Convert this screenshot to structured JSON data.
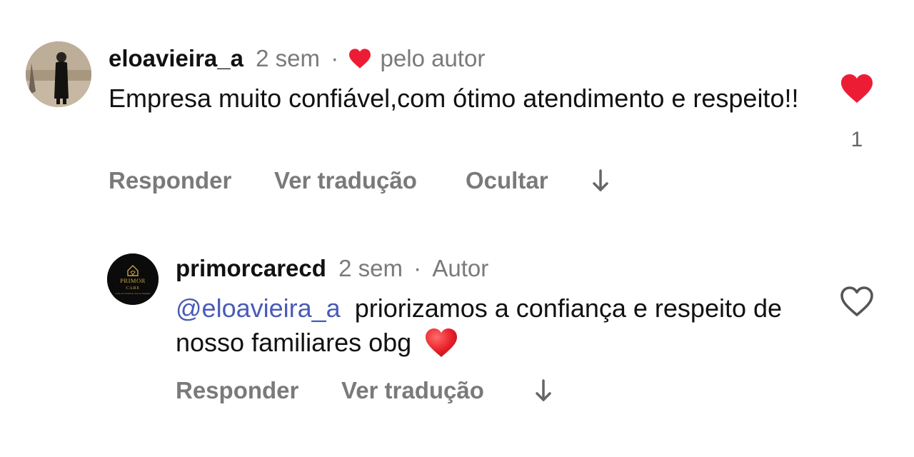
{
  "comments": [
    {
      "username": "eloavieira_a",
      "time": "2 sem",
      "separator": "·",
      "liked_by_author_text": "pelo autor",
      "text": "Empresa muito confiável,com ótimo atendimento e respeito!!",
      "actions": {
        "reply": "Responder",
        "translate": "Ver tradução",
        "hide": "Ocultar"
      },
      "like_count": "1",
      "liked": true
    },
    {
      "username": "primorcarecd",
      "time": "2 sem",
      "separator": "·",
      "author_badge": "Autor",
      "mention": "@eloavieira_a",
      "text": "priorizamos a confiança e respeito de nosso familiares obg",
      "emoji": "❤️",
      "avatar_logo": {
        "line1": "PRIMOR",
        "line2": "CARE",
        "tagline": "Cuide com excelência, viva com dignidade"
      },
      "actions": {
        "reply": "Responder",
        "translate": "Ver tradução"
      },
      "liked": false
    }
  ],
  "colors": {
    "heart": "#ed1c35",
    "mention": "#4a5bb6",
    "muted": "#7a7a7a"
  },
  "icons": {
    "like_filled": "heart-filled-icon",
    "like_outline": "heart-outline-icon",
    "more": "arrow-down-icon",
    "author_like": "heart-filled-icon"
  }
}
